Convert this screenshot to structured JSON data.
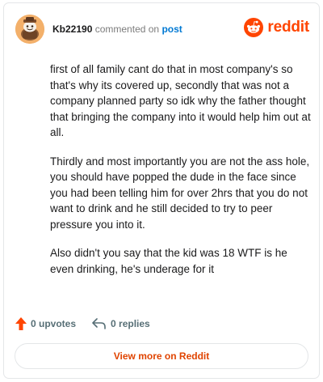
{
  "comment": {
    "username": "Kb22190",
    "action_text": "commented on",
    "post_link_label": "post",
    "paragraphs": [
      "first of all family cant do that in most company's so that's why its covered up, secondly that was not a company planned party so idk why the father thought that bringing the company into it would help him out at all.",
      "Thirdly and most importantly you are not the ass hole, you should have popped the dude in the face since you had been telling him for over 2hrs that you do not want to drink and he still decided to try to peer pressure you into it.",
      "Also didn't you say that the kid was 18 WTF is he even drinking, he's underage for it"
    ]
  },
  "brand": {
    "name": "reddit",
    "icon": "reddit-alien-icon",
    "color": "#ff4500"
  },
  "actions": {
    "upvotes_label": "0 upvotes",
    "replies_label": "0 replies",
    "upvote_icon": "upvote-arrow-icon",
    "reply_icon": "reply-arrow-icon",
    "upvote_color": "#ff4500"
  },
  "footer": {
    "view_more_label": "View more on Reddit"
  }
}
